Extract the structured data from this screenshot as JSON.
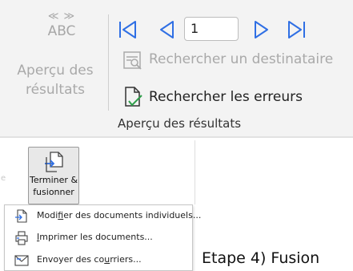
{
  "ribbon": {
    "preview_icon_chevrons": "≪ ≫",
    "preview_icon_text": "ABC",
    "preview_label_line1": "Aperçu des",
    "preview_label_line2": "résultats",
    "record_number": "1",
    "find_recipient_label": "Rechercher un destinataire",
    "check_errors_label": "Rechercher les erreurs",
    "group_label": "Aperçu des résultats",
    "nav_color": "#2f6fe4",
    "disabled_color": "#a9a9a9"
  },
  "finish": {
    "left_strip_char": "e",
    "button_line1": "Terminer &",
    "button_line2": "fusionner",
    "button_chevron": "⌄",
    "menu": [
      {
        "pre": "Modi",
        "ul": "f",
        "post": "ier des documents individuels..."
      },
      {
        "pre": "",
        "ul": "I",
        "post": "mprimer les documents..."
      },
      {
        "pre": "Envoyer des co",
        "ul": "u",
        "post": "rriers..."
      }
    ]
  },
  "caption": "Etape 4) Fusion"
}
